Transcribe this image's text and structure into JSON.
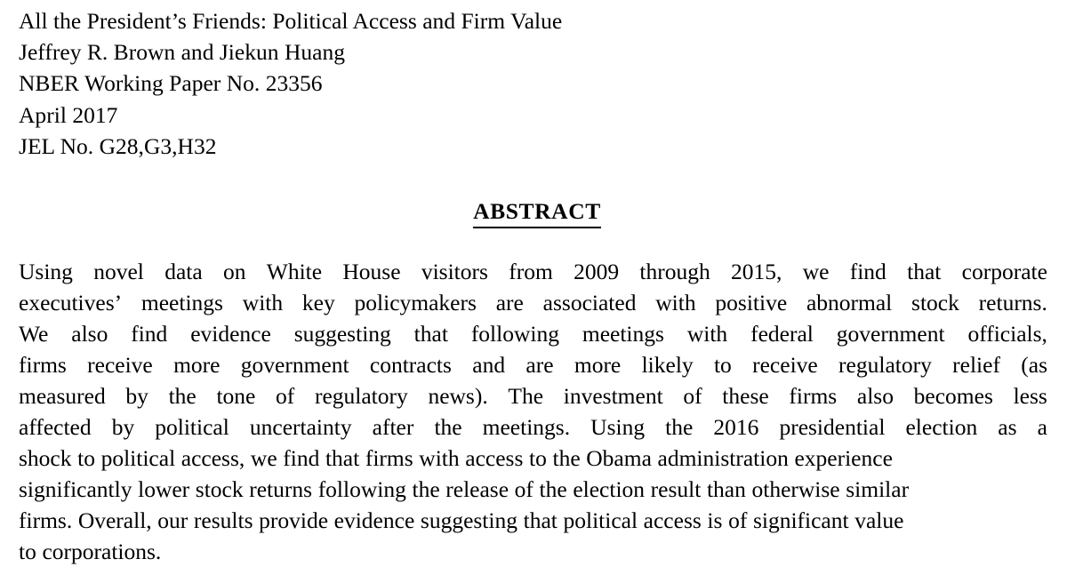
{
  "document": {
    "type": "working-paper-abstract-page",
    "background_color": "#ffffff",
    "text_color": "#000000"
  },
  "frontmatter": {
    "title": "All the President’s Friends: Political Access and Firm Value",
    "authors": "Jeffrey R. Brown and Jiekun Huang",
    "series": "NBER Working Paper No. 23356",
    "date": "April 2017",
    "jel": "JEL No. G28,G3,H32"
  },
  "abstract": {
    "heading": "ABSTRACT",
    "full_text": "Using novel data on White House visitors from 2009 through 2015, we find that corporate executives’ meetings with key policymakers are associated with positive abnormal stock returns. We also find evidence suggesting that following meetings with federal government officials, firms receive more government contracts and are more likely to receive regulatory relief (as measured by the tone of regulatory news). The investment of these firms also becomes less affected by political uncertainty after the meetings. Using the 2016 presidential election as a shock to political access, we find that firms with access to the Obama administration experience significantly lower stock returns following the release of the election result than otherwise similar firms. Overall, our results provide evidence suggesting that political access is of significant value to corporations.",
    "lines": [
      {
        "align": "justify",
        "words": [
          "Using",
          "novel",
          "data",
          "on",
          "White",
          "House",
          "visitors",
          "from",
          "2009",
          "through",
          "2015,",
          "we",
          "find",
          "that",
          "corporate"
        ]
      },
      {
        "align": "justify",
        "words": [
          "executives’",
          "meetings",
          "with",
          "key",
          "policymakers",
          "are",
          "associated",
          "with",
          "positive",
          "abnormal",
          "stock",
          "returns."
        ]
      },
      {
        "align": "justify",
        "words": [
          "We",
          "also",
          "find",
          "evidence",
          "suggesting",
          "that",
          "following",
          "meetings",
          "with",
          "federal",
          "government",
          "officials,"
        ]
      },
      {
        "align": "justify",
        "words": [
          "firms",
          "receive",
          "more",
          "government",
          "contracts",
          "and",
          "are",
          "more",
          "likely",
          "to",
          "receive",
          "regulatory",
          "relief",
          "(as"
        ]
      },
      {
        "align": "justify",
        "words": [
          "measured",
          "by",
          "the",
          "tone",
          "of",
          "regulatory",
          "news).",
          "The",
          "investment",
          "of",
          "these",
          "firms",
          "also",
          "becomes",
          "less"
        ]
      },
      {
        "align": "justify",
        "words": [
          "affected",
          "by",
          "political",
          "uncertainty",
          "after",
          "the",
          "meetings.",
          "Using",
          "the",
          "2016",
          "presidential",
          "election",
          "as",
          "a"
        ]
      },
      {
        "align": "flush",
        "words": [
          "shock",
          "to",
          "political",
          "access,",
          "we",
          "find",
          "that",
          "firms",
          "with",
          "access",
          "to",
          "the",
          "Obama",
          "administration",
          "experience"
        ]
      },
      {
        "align": "flush",
        "words": [
          "significantly",
          "lower",
          "stock",
          "returns",
          "following",
          "the",
          "release",
          "of",
          "the",
          "election",
          "result",
          "than",
          "otherwise",
          "similar"
        ]
      },
      {
        "align": "flush",
        "words": [
          "firms.",
          "Overall,",
          "our",
          "results",
          "provide",
          "evidence",
          "suggesting",
          "that",
          "political",
          "access",
          "is",
          "of",
          "significant",
          "value"
        ]
      },
      {
        "align": "flush",
        "words": [
          "to",
          "corporations."
        ]
      }
    ]
  }
}
